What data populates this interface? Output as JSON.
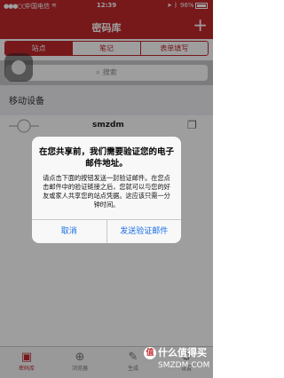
{
  "status": {
    "carrier": "中国电信",
    "time": "12:39",
    "battery": "96%",
    "signal": "●●●○○",
    "wifi": "≋"
  },
  "nav": {
    "title": "密码库",
    "add_label": "+"
  },
  "segments": [
    "站点",
    "笔记",
    "表单填写"
  ],
  "search": {
    "placeholder": "搜索",
    "icon": "search-icon"
  },
  "section": {
    "label": "移动设备"
  },
  "row": {
    "name": "smzdm"
  },
  "dialog": {
    "title": "在您共享前，我们需要验证您的电子邮件地址。",
    "message": "请点击下面的按钮发送一封验证邮件。在您点击邮件中的验证链接之后，您就可以与您的好友或家人共享您的站点凭据。这应该只需一分钟时间。",
    "cancel": "取消",
    "confirm": "发送验证邮件"
  },
  "tabs": [
    "密码库",
    "浏览器",
    "生成",
    "设置"
  ],
  "watermark": {
    "line1": "什么值得买",
    "line2": "SMZDM.COM",
    "logo": "值"
  },
  "colors": {
    "brand": "#c1272d",
    "link": "#1a6ee8"
  }
}
